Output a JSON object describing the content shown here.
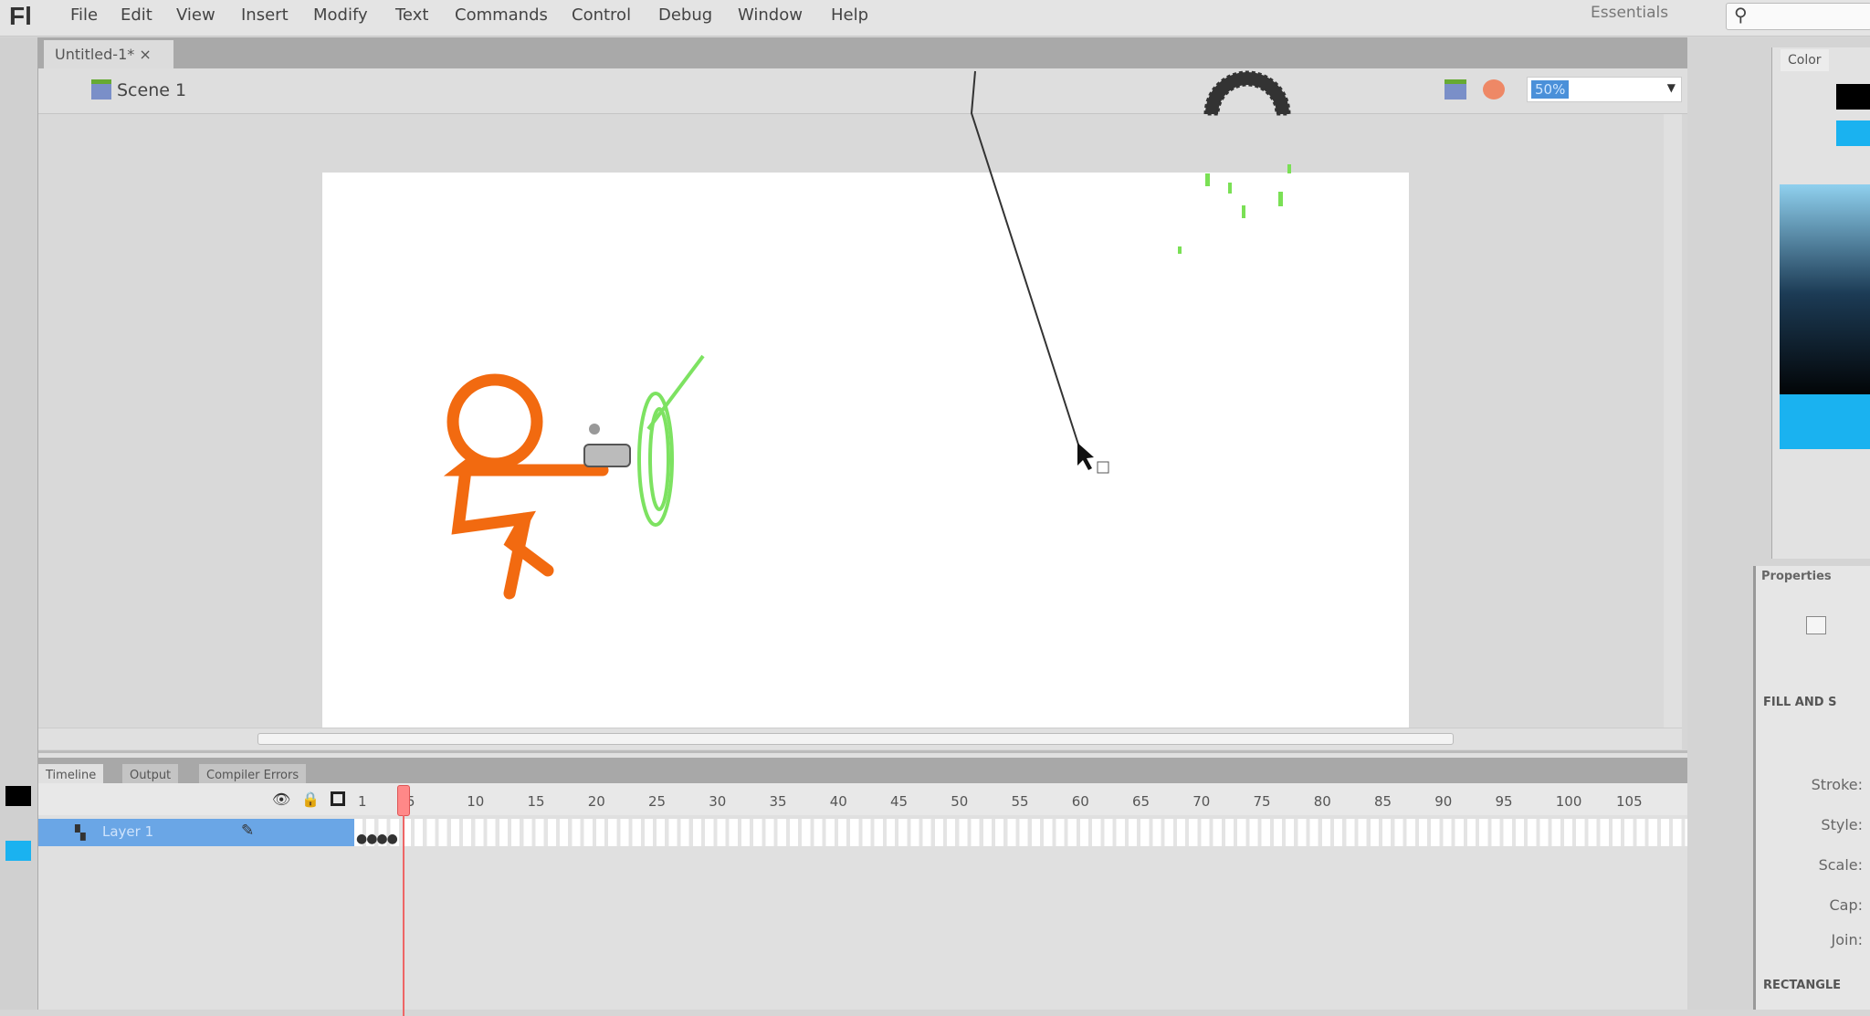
{
  "app": {
    "logo": "Fl",
    "workspace": "Essentials",
    "search_icon": "magnifier-icon"
  },
  "menu": [
    "File",
    "Edit",
    "View",
    "Insert",
    "Modify",
    "Text",
    "Commands",
    "Control",
    "Debug",
    "Window",
    "Help"
  ],
  "document": {
    "tab": "Untitled-1*",
    "close": "×",
    "scene": "Scene 1",
    "zoom": "50%"
  },
  "timeline": {
    "tabs": [
      "Timeline",
      "Output",
      "Compiler Errors"
    ],
    "layer": "Layer 1",
    "frame_numbers": [
      "1",
      "5",
      "10",
      "15",
      "20",
      "25",
      "30",
      "35",
      "40",
      "45",
      "50",
      "55",
      "60",
      "65",
      "70",
      "75",
      "80",
      "85",
      "90",
      "95",
      "100",
      "105"
    ],
    "current_frame": 5
  },
  "panels": {
    "color_tab": "Color",
    "properties_tab": "Properties",
    "fill_and_stroke": "FILL AND S",
    "stroke": "Stroke:",
    "style": "Style:",
    "scale": "Scale:",
    "cap": "Cap:",
    "join": "Join:",
    "rectangle": "RECTANGLE"
  },
  "colors": {
    "stroke": "#000000",
    "fill": "#1ab2f0",
    "figure": "#f26a10",
    "effect": "#5ddc3a"
  }
}
